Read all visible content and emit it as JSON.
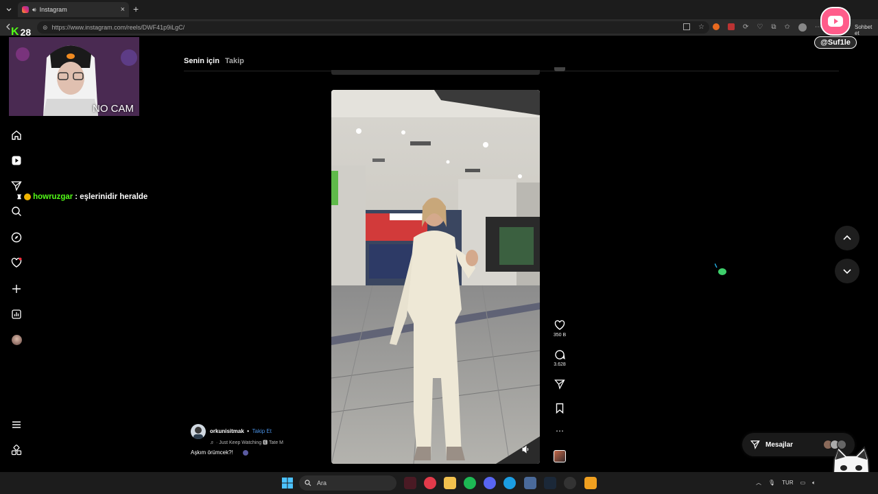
{
  "browser": {
    "tab_title": "Instagram",
    "url": "https://www.instagram.com/reels/DWF41p9iLgC/",
    "url_tail_text": "Sohbet et"
  },
  "feed": {
    "tabs": [
      {
        "label": "Senin için",
        "active": true
      },
      {
        "label": "Takip",
        "active": false
      }
    ]
  },
  "reel": {
    "likes": "350 B",
    "comments": "3.628",
    "author": "orkunisitmak",
    "separator": "•",
    "follow_label": "Takip Et",
    "music": "♬ · Just Keep Watching 🅴 Tate M",
    "caption": "Aşkım örümcek?!"
  },
  "messages": {
    "label": "Mesajlar"
  },
  "stream": {
    "kick_count": "28",
    "nocam": "NO CAM",
    "chat_user": "howruzgar",
    "chat_message": ": eşlerinidir heralde",
    "yt_handle": "@Suf1le"
  },
  "taskbar": {
    "search_placeholder": "Ara",
    "lang": "TUR"
  },
  "colors": {
    "kick_green": "#53fc18",
    "instagram_link": "#4a90e2",
    "yt_pink": "#ff5c8a"
  }
}
